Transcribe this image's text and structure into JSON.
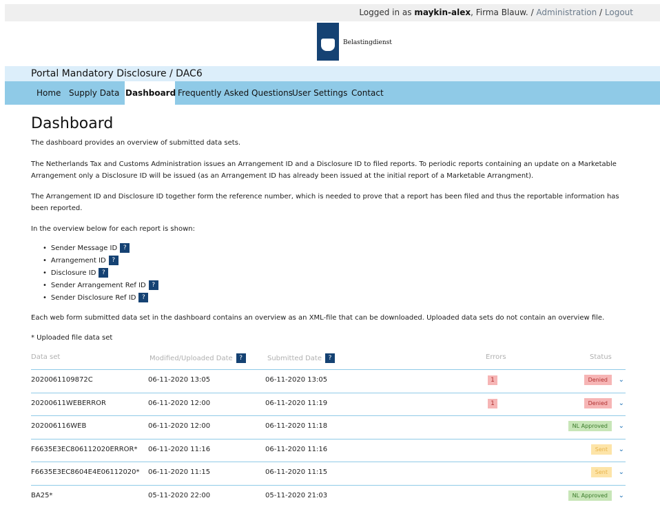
{
  "topbar": {
    "logged_in_prefix": "Logged in as ",
    "user": "maykin-alex",
    "org": ", Firma Blauw. / ",
    "admin": "Administration",
    "sep": " / ",
    "logout": "Logout"
  },
  "logo": {
    "text": "Belastingdienst"
  },
  "portal": {
    "title": "Portal Mandatory Disclosure / DAC6"
  },
  "nav": {
    "home": "Home",
    "supply": "Supply Data",
    "dashboard": "Dashboard",
    "faq": "Frequently Asked Questions",
    "settings": "User Settings",
    "contact": "Contact"
  },
  "page": {
    "title": "Dashboard",
    "intro": "The dashboard provides an overview of submitted data sets.",
    "p1": "The Netherlands Tax and Customs Administration issues an Arrangement ID and a Disclosure ID to filed reports. To periodic reports containing an update on a Marketable Arrangement only a Disclosure ID will be issued (as an Arrangement ID has already been issued at the initial report of a Marketable Arrangment).",
    "p2": "The Arrangement ID and Disclosure ID together form the reference number, which is needed to prove that a report has been filed and thus the reportable information has been reported.",
    "p3": "In the overview below for each report is shown:",
    "bullets": [
      "Sender Message ID",
      "Arrangement ID",
      "Disclosure ID",
      "Sender Arrangement Ref ID",
      "Sender Disclosure Ref ID"
    ],
    "help_glyph": "?",
    "p4": "Each web form submitted data set in the dashboard contains an overview as an XML-file that can be downloaded. Uploaded data sets do not contain an overview file.",
    "p5": "* Uploaded file data set"
  },
  "table": {
    "headers": {
      "dataset": "Data set",
      "modified": "Modified/Uploaded Date",
      "submitted": "Submitted Date",
      "errors": "Errors",
      "status": "Status"
    },
    "chevron": "⌄",
    "rows": [
      {
        "dataset": "2020061109872C",
        "modified": "06-11-2020 13:05",
        "submitted": "06-11-2020 13:05",
        "errors": "1",
        "status": "Denied",
        "status_type": "denied"
      },
      {
        "dataset": "20200611WEBERROR",
        "modified": "06-11-2020 12:00",
        "submitted": "06-11-2020 11:19",
        "errors": "1",
        "status": "Denied",
        "status_type": "denied"
      },
      {
        "dataset": "202006116WEB",
        "modified": "06-11-2020 12:00",
        "submitted": "06-11-2020 11:18",
        "errors": "",
        "status": "NL Approved",
        "status_type": "approved"
      },
      {
        "dataset": "F6635E3EC806112020ERROR*",
        "modified": "06-11-2020 11:16",
        "submitted": "06-11-2020 11:16",
        "errors": "",
        "status": "Sent",
        "status_type": "sent"
      },
      {
        "dataset": "F6635E3EC8604E4E06112020*",
        "modified": "06-11-2020 11:15",
        "submitted": "06-11-2020 11:15",
        "errors": "",
        "status": "Sent",
        "status_type": "sent"
      },
      {
        "dataset": "BA25*",
        "modified": "05-11-2020 22:00",
        "submitted": "05-11-2020 21:03",
        "errors": "",
        "status": "NL Approved",
        "status_type": "approved"
      }
    ]
  },
  "colors": {
    "brand": "#154273",
    "nav": "#8fcae7",
    "portal_bar": "#dceefa"
  }
}
